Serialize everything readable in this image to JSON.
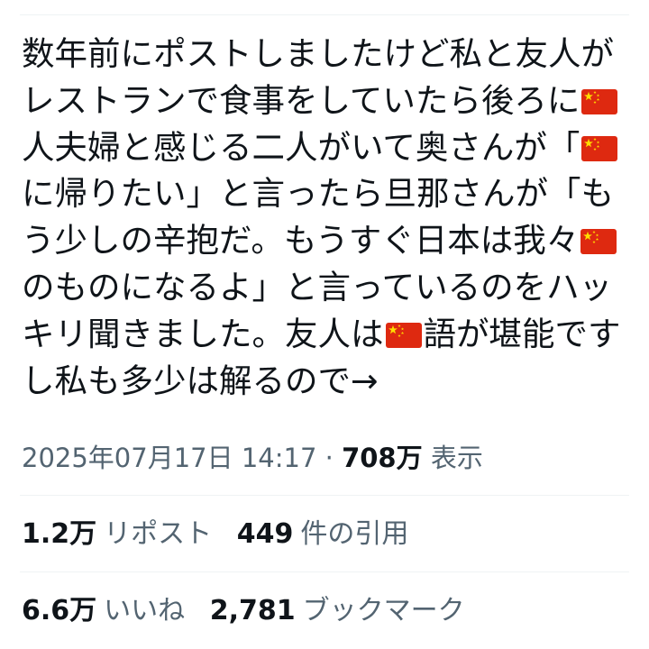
{
  "post": {
    "segments": [
      {
        "type": "text",
        "text": "数年前にポストしましたけど私と友人がレストランで食事をしていたら後ろに"
      },
      {
        "type": "flag",
        "icon": "china-flag-icon"
      },
      {
        "type": "text",
        "text": "人夫婦と感じる二人がいて奥さんが「"
      },
      {
        "type": "flag",
        "icon": "china-flag-icon"
      },
      {
        "type": "text",
        "text": "に帰りたい」と言ったら旦那さんが「もう少しの辛抱だ。もうすぐ日本は我々"
      },
      {
        "type": "flag",
        "icon": "china-flag-icon"
      },
      {
        "type": "text",
        "text": "のものになるよ」と言っているのをハッキリ聞きました。友人は"
      },
      {
        "type": "flag",
        "icon": "china-flag-icon"
      },
      {
        "type": "text",
        "text": "語が堪能ですし私も多少は解るので→"
      }
    ]
  },
  "meta": {
    "timestamp": "2025年07月17日 14:17",
    "separator": " · ",
    "views_count": "708万",
    "views_label": " 表示"
  },
  "stats_row1": {
    "reposts_count": "1.2万",
    "reposts_label": "リポスト",
    "quotes_count": "449",
    "quotes_label": "件の引用"
  },
  "stats_row2": {
    "likes_count": "6.6万",
    "likes_label": "いいね",
    "bookmarks_count": "2,781",
    "bookmarks_label": "ブックマーク"
  },
  "colors": {
    "text": "#0f1419",
    "secondary": "#536471",
    "divider": "#eff3f4",
    "flag_red": "#de2910",
    "flag_yellow": "#ffde00"
  }
}
